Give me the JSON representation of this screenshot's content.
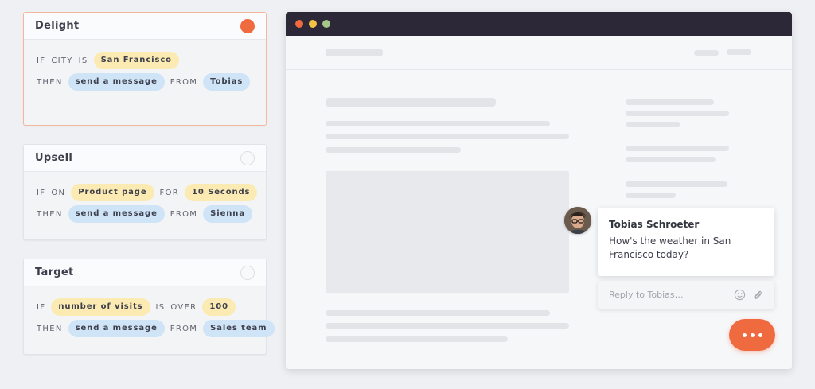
{
  "rules": [
    {
      "title": "Delight",
      "active": true,
      "lines": [
        [
          {
            "t": "kw",
            "v": "IF"
          },
          {
            "t": "kw",
            "v": "CITY"
          },
          {
            "t": "kw",
            "v": "IS"
          },
          {
            "t": "chip",
            "c": "yellow",
            "v": "San Francisco"
          }
        ],
        [
          {
            "t": "kw",
            "v": "THEN"
          },
          {
            "t": "chip",
            "c": "blue",
            "v": "send a message"
          },
          {
            "t": "kw",
            "v": "FROM"
          },
          {
            "t": "chip",
            "c": "blue",
            "v": "Tobias"
          }
        ]
      ]
    },
    {
      "title": "Upsell",
      "active": false,
      "lines": [
        [
          {
            "t": "kw",
            "v": "IF"
          },
          {
            "t": "kw",
            "v": "ON"
          },
          {
            "t": "chip",
            "c": "yellow",
            "v": "Product page"
          },
          {
            "t": "kw",
            "v": "FOR"
          },
          {
            "t": "chip",
            "c": "yellow",
            "v": "10 Seconds"
          }
        ],
        [
          {
            "t": "kw",
            "v": "THEN"
          },
          {
            "t": "chip",
            "c": "blue",
            "v": "send a message"
          },
          {
            "t": "kw",
            "v": "FROM"
          },
          {
            "t": "chip",
            "c": "blue",
            "v": "Sienna"
          }
        ]
      ]
    },
    {
      "title": "Target",
      "active": false,
      "lines": [
        [
          {
            "t": "kw",
            "v": "IF"
          },
          {
            "t": "chip",
            "c": "yellow",
            "v": "number of visits"
          },
          {
            "t": "kw",
            "v": "IS"
          },
          {
            "t": "kw",
            "v": "OVER"
          },
          {
            "t": "chip",
            "c": "yellow",
            "v": "100"
          }
        ],
        [
          {
            "t": "kw",
            "v": "THEN"
          },
          {
            "t": "chip",
            "c": "blue",
            "v": "send a message"
          },
          {
            "t": "kw",
            "v": "FROM"
          },
          {
            "t": "chip",
            "c": "blue",
            "v": "Sales team"
          }
        ]
      ]
    }
  ],
  "chat": {
    "sender": "Tobias Schroeter",
    "message": "How's the weather in San Francisco today?",
    "reply_placeholder": "Reply to Tobias…"
  },
  "colors": {
    "accent": "#f06a3f",
    "window_bar": "#2c2837",
    "chip_yellow": "#fbebb2",
    "chip_blue": "#cfe4f6",
    "window_dots": [
      "#f06a3f",
      "#f5c344",
      "#a5c78a"
    ]
  },
  "icons": {
    "emoji": "smiley-icon",
    "attach": "paperclip-icon",
    "launcher": "ellipsis-icon"
  }
}
